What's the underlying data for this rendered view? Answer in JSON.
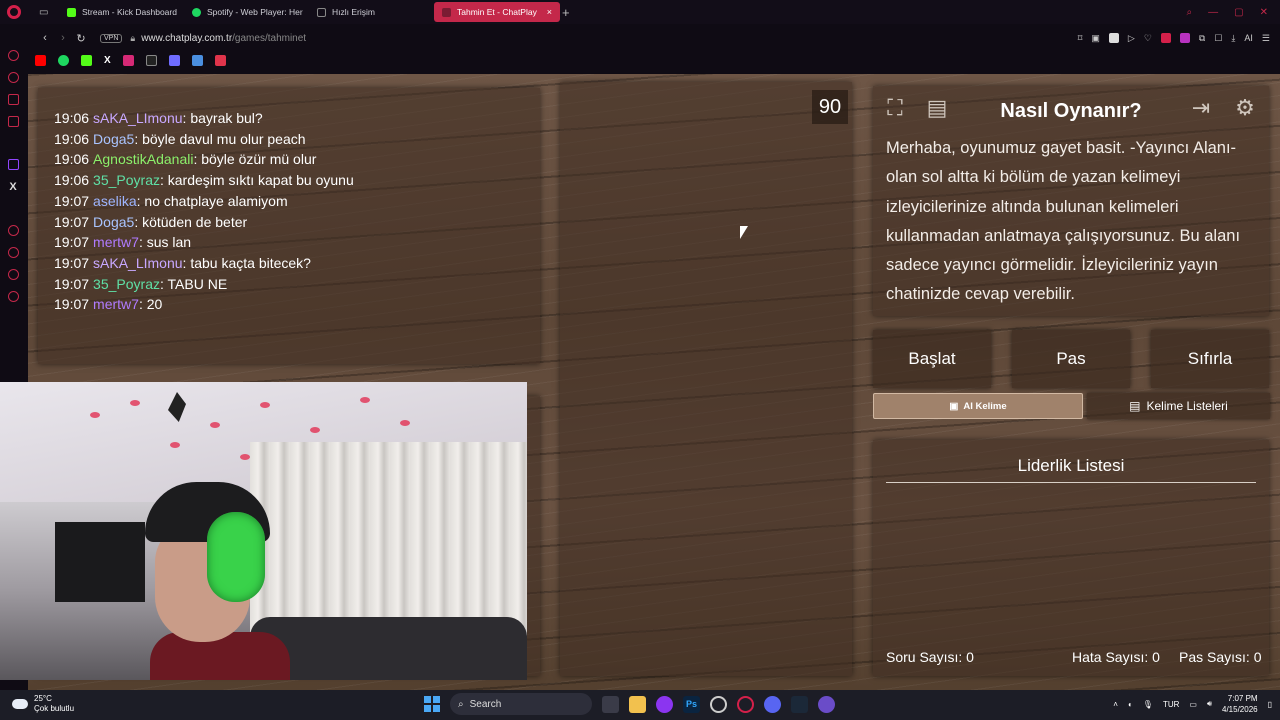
{
  "browser": {
    "tabs": [
      {
        "label": "Stream - Kick Dashboard",
        "color": "#53fc18"
      },
      {
        "label": "Spotify - Web Player: Her",
        "color": "#1ed760"
      },
      {
        "label": "Hızlı Erişim",
        "color": "#888888"
      },
      {
        "label": "Tahmin Et - ChatPlay",
        "color": "#c4284a",
        "active": true
      }
    ],
    "new_tab_icon": "+",
    "vpn_label": "VPN",
    "url_host": "www.chatplay.com.tr",
    "url_path": "/games/tahminet",
    "ai_label": "AI"
  },
  "chat": {
    "messages": [
      {
        "time": "19:06",
        "user": "sAKA_LImonu",
        "color": "#c8a8ff",
        "text": "bayrak bul?"
      },
      {
        "time": "19:06",
        "user": "Doga5",
        "color": "#a9c4ff",
        "text": "böyle davul mu olur peach"
      },
      {
        "time": "19:06",
        "user": "AgnostikAdanali",
        "color": "#8cf06b",
        "text": "böyle özür mü olur"
      },
      {
        "time": "19:06",
        "user": "35_Poyraz",
        "color": "#5fe0a6",
        "text": "kardeşim sıktı kapat bu oyunu"
      },
      {
        "time": "19:07",
        "user": "aselika",
        "color": "#9db5ff",
        "text": "no chatplaye alamiyom"
      },
      {
        "time": "19:07",
        "user": "Doga5",
        "color": "#a9c4ff",
        "text": "kötüden de beter"
      },
      {
        "time": "19:07",
        "user": "mertw7",
        "color": "#b07bff",
        "text": "sus lan"
      },
      {
        "time": "19:07",
        "user": "sAKA_LImonu",
        "color": "#c8a8ff",
        "text": "tabu kaçta bitecek?"
      },
      {
        "time": "19:07",
        "user": "35_Poyraz",
        "color": "#5fe0a6",
        "text": "TABU NE"
      },
      {
        "time": "19:07",
        "user": "mertw7",
        "color": "#b07bff",
        "text": "20"
      }
    ]
  },
  "game": {
    "timer": "90",
    "help_title": "Nasıl Oynanır?",
    "help_text": "Merhaba, oyunumuz gayet basit. -Yayıncı Alanı- olan sol altta ki bölüm de yazan kelimeyi izleyicilerinize altında bulunan kelimeleri kullanmadan anlatmaya çalışıyorsunuz. Bu alanı sadece yayıncı görmelidir. İzleyicileriniz yayın chatinizde cevap verebilir.",
    "buttons": {
      "start": "Başlat",
      "pass": "Pas",
      "reset": "Sıfırla"
    },
    "ai_word": "AI Kelime",
    "word_lists": "Kelime Listeleri",
    "leaderboard_title": "Liderlik Listesi",
    "stats": {
      "questions_label": "Soru Sayısı:",
      "questions_value": "0",
      "errors_label": "Hata Sayısı:",
      "errors_value": "0",
      "passes_label": "Pas Sayısı:",
      "passes_value": "0"
    }
  },
  "taskbar": {
    "temperature": "25°C",
    "weather": "Çok bulutlu",
    "search": "Search",
    "language": "TUR",
    "time": "7:07 PM",
    "date": "4/15/2026"
  }
}
